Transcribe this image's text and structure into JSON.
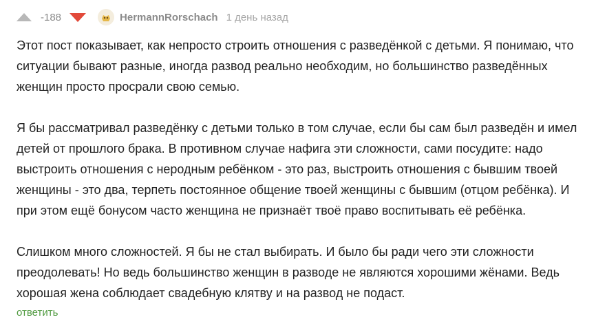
{
  "comment": {
    "rating": "-188",
    "author": "HermannRorschach",
    "timestamp": "1 день назад",
    "paragraphs": [
      "Этот пост показывает, как непросто строить отношения с разведёнкой с детьми. Я понимаю, что ситуации бывают разные, иногда развод реально необходим, но большинство разведённых женщин просто просрали свою семью.",
      "Я бы рассматривал разведёнку с детьми только в том случае, если бы сам был разведён и имел детей от прошлого брака. В противном случае нафига эти сложности, сами посудите: надо выстроить отношения с неродным ребёнком - это раз, выстроить отношения с бывшим твоей женщины - это два, терпеть постоянное общение твоей женщины с бывшим (отцом ребёнка). И при этом ещё бонусом часто женщина не признаёт твоё право воспитывать её ребёнка.",
      "Слишком много сложностей. Я бы не стал выбирать. И было бы ради чего эти сложности преодолевать! Но ведь большинство женщин в разводе не являются хорошими жёнами. Ведь хорошая жена соблюдает свадебную клятву и на развод не подаст."
    ],
    "reply_label": "ответить"
  },
  "icons": {
    "upvote": "arrow-up-icon",
    "downvote": "arrow-down-icon",
    "avatar": "avatar-icon"
  },
  "colors": {
    "upvote": "#b8b8b8",
    "downvote": "#e2493a",
    "reply_link": "#4f9a3f",
    "muted_text": "#8b8b8b",
    "body_text": "#222222"
  }
}
